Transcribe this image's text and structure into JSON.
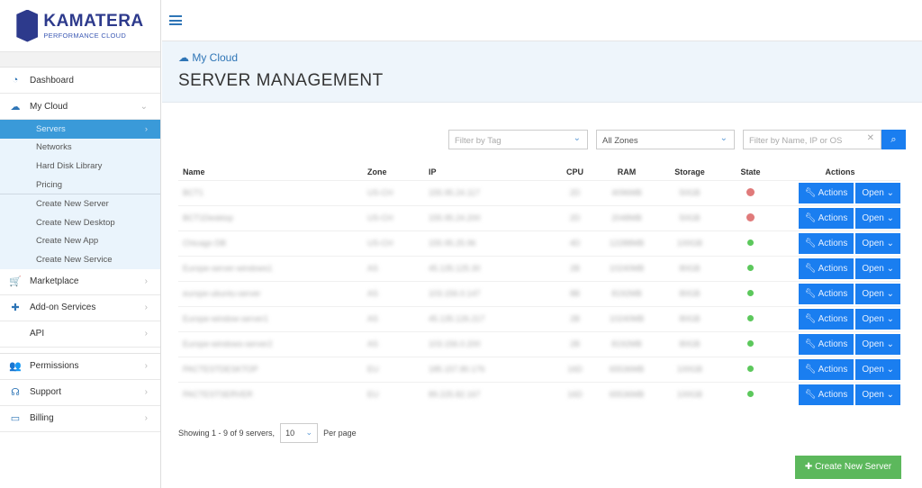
{
  "brand": {
    "name": "KAMATERA",
    "tagline": "PERFORMANCE CLOUD"
  },
  "sidebar": {
    "items": [
      {
        "label": "Dashboard",
        "icon": "dashboard-icon"
      },
      {
        "label": "My Cloud",
        "icon": "cloud-icon"
      }
    ],
    "sub": [
      "Servers",
      "Networks",
      "Hard Disk Library",
      "Pricing"
    ],
    "sub2": [
      "Create New Server",
      "Create New Desktop",
      "Create New App",
      "Create New Service"
    ],
    "items2": [
      {
        "label": "Marketplace",
        "icon": "cart-icon"
      },
      {
        "label": "Add-on Services",
        "icon": "puzzle-icon"
      },
      {
        "label": "API",
        "icon": "code-icon"
      }
    ],
    "items3": [
      {
        "label": "Permissions",
        "icon": "users-icon"
      },
      {
        "label": "Support",
        "icon": "headset-icon"
      },
      {
        "label": "Billing",
        "icon": "card-icon"
      }
    ]
  },
  "header": {
    "breadcrumb": "My Cloud",
    "title": "SERVER MANAGEMENT"
  },
  "filters": {
    "tag_placeholder": "Filter by Tag",
    "zone": "All Zones",
    "search_placeholder": "Filter by Name, IP or OS"
  },
  "table": {
    "headers": [
      "Name",
      "Zone",
      "IP",
      "CPU",
      "RAM",
      "Storage",
      "State",
      "Actions"
    ],
    "rows": [
      {
        "name": "BCT1",
        "zone": "US-CH",
        "ip": "155.95.24.117",
        "cpu": "2D",
        "ram": "4096MB",
        "storage": "50GB",
        "state": "stopped"
      },
      {
        "name": "BCT1Desktop",
        "zone": "US-CH",
        "ip": "155.95.24.200",
        "cpu": "2D",
        "ram": "2048MB",
        "storage": "50GB",
        "state": "stopped"
      },
      {
        "name": "Chicago DB",
        "zone": "US-CH",
        "ip": "155.95.25.96",
        "cpu": "4D",
        "ram": "12288MB",
        "storage": "100GB",
        "state": "running"
      },
      {
        "name": "Europe-server-windows1",
        "zone": "AS",
        "ip": "45.135.125.30",
        "cpu": "2B",
        "ram": "10240MB",
        "storage": "80GB",
        "state": "running"
      },
      {
        "name": "europe-ubuntu-server",
        "zone": "AS",
        "ip": "103.156.0.147",
        "cpu": "8B",
        "ram": "8192MB",
        "storage": "80GB",
        "state": "running"
      },
      {
        "name": "Europe-window-server1",
        "zone": "AS",
        "ip": "45.135.126.217",
        "cpu": "2B",
        "ram": "10240MB",
        "storage": "80GB",
        "state": "running"
      },
      {
        "name": "Europe-windows-server2",
        "zone": "AS",
        "ip": "103.156.0.200",
        "cpu": "2B",
        "ram": "8192MB",
        "storage": "80GB",
        "state": "running"
      },
      {
        "name": "PACTESTDESKTOP",
        "zone": "EU",
        "ip": "185.157.80.176",
        "cpu": "16D",
        "ram": "65536MB",
        "storage": "100GB",
        "state": "running"
      },
      {
        "name": "PACTESTSERVER",
        "zone": "EU",
        "ip": "89.225.82.167",
        "cpu": "16D",
        "ram": "65536MB",
        "storage": "100GB",
        "state": "running"
      }
    ],
    "actions_label": "Actions",
    "open_label": "Open"
  },
  "pagination": {
    "showing": "Showing 1 - 9 of 9 servers,",
    "per_page_value": "10",
    "per_page_label": "Per page"
  },
  "create_button": "Create New Server",
  "colors": {
    "primary": "#1a7ef0",
    "success": "#5cb85c",
    "stopped": "#e07a7a",
    "running": "#5cc85c"
  }
}
